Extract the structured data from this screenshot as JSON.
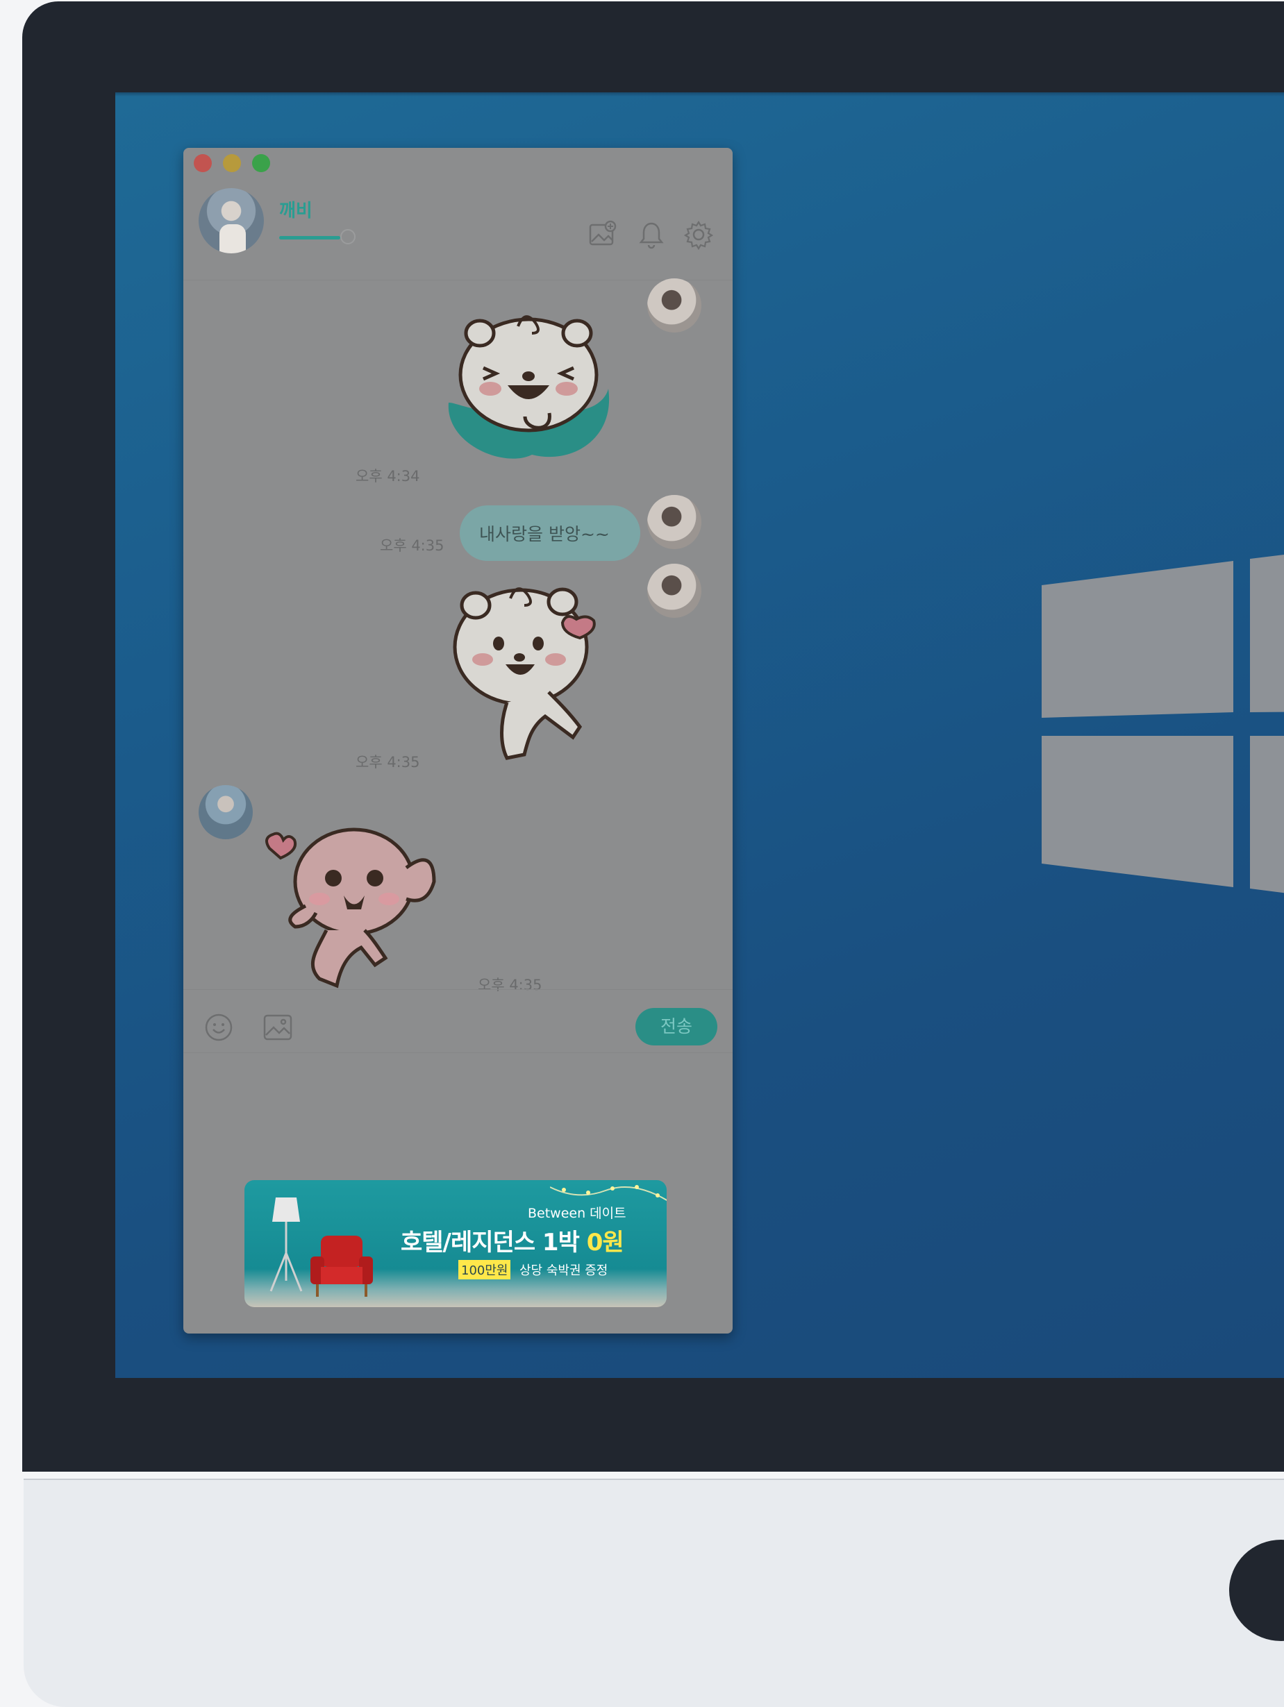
{
  "chat": {
    "contact_name": "깨비",
    "messages": [
      {
        "type": "sticker",
        "time": "오후 4:34"
      },
      {
        "type": "text",
        "text": "내사랑을 받앙~~",
        "time": "오후 4:35"
      },
      {
        "type": "sticker",
        "time": "오후 4:35"
      },
      {
        "type": "sticker",
        "time": "오후 4:35"
      }
    ],
    "send_label": "전송"
  },
  "banner": {
    "brand": "Between 데이트",
    "title_prefix": "호텔/레지던스 1박 ",
    "title_highlight": "0원",
    "sub_badge": "100만원",
    "sub_text": "상당 숙박권 증정"
  },
  "colors": {
    "accent": "#2a9d92",
    "screen": "#1b5c8c",
    "bezel": "#21262f"
  }
}
